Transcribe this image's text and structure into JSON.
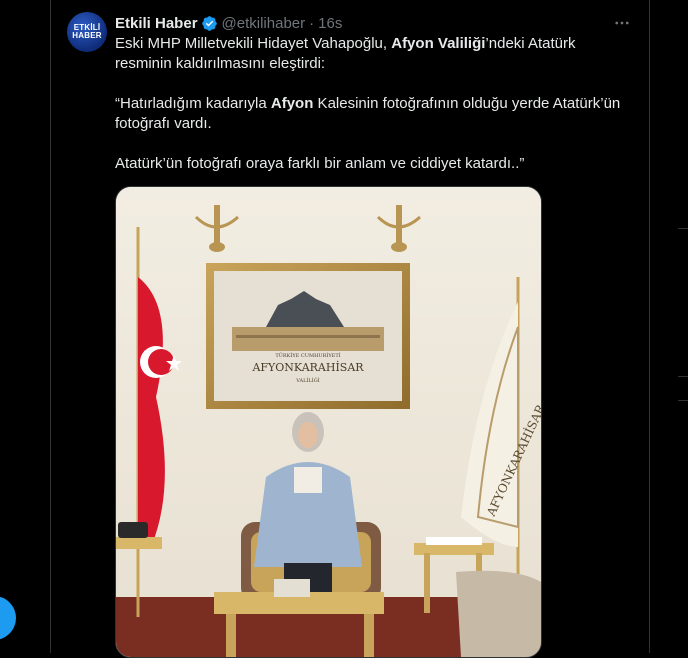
{
  "tweet": {
    "avatar_text_1": "ETKİLİ",
    "avatar_text_2": "HABER",
    "name": "Etkili Haber",
    "handle": "@etkilihaber",
    "separator": "·",
    "time": "16s",
    "more_label": "···",
    "line1_pre": "Eski MHP Milletvekili Hidayet Vahapoğlu, ",
    "line1_bold": "Afyon Valiliği",
    "line1_post": "’ndeki Atatürk resminin kaldırılmasını eleştirdi:",
    "quote_pre": "“Hatırladığım kadarıyla ",
    "quote_bold": "Afyon",
    "quote_post": " Kalesinin fotoğrafının olduğu yerde Atatürk’ün fotoğrafı vardı.",
    "line3": "Atatürk’ün fotoğrafı oraya farklı bir anlam ve ciddiyet katardı..”"
  },
  "photo": {
    "frame_line1": "TÜRKİYE CUMHURİYETİ",
    "frame_line2": "AFYONKARAHİSAR",
    "frame_line3": "VALİLİĞİ",
    "banner_text": "AFYONKARAHİSAR"
  },
  "colors": {
    "accent": "#1d9bf0",
    "background": "#000000",
    "text": "#e7e9ea",
    "muted": "#71767b"
  }
}
